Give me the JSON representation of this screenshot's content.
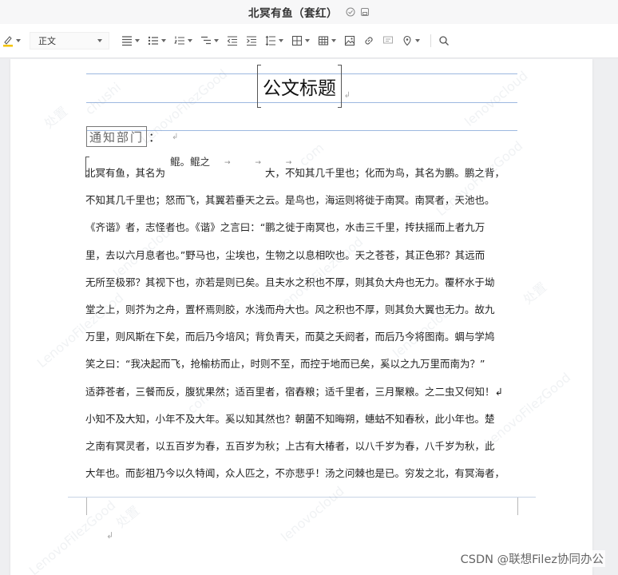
{
  "window": {
    "title": "北冥有鱼（套红）",
    "status_icons": [
      "check-circle-icon",
      "save-icon"
    ]
  },
  "toolbar": {
    "paragraph_style": "正文",
    "tools": [
      "highlight-pen-icon",
      "align-icon",
      "bullet-list-icon",
      "numbered-list-icon",
      "multilevel-list-icon",
      "outdent-icon",
      "indent-icon",
      "line-spacing-icon",
      "border-icon",
      "table-icon",
      "image-icon",
      "link-icon",
      "comment-icon",
      "location-icon",
      "search-icon"
    ]
  },
  "document": {
    "heading": "公文标题",
    "paragraph_mark": "↲",
    "notice_label": "通知部门",
    "notice_colon": "：",
    "fish_line": "鲲。鲲之",
    "arrows": "→ → →",
    "lines": [
      "北冥有鱼，其名为　　　　　　　　　　大，不知其几千里也；化而为鸟，其名为鹏。鹏之背，",
      "不知其几千里也；怒而飞，其翼若垂天之云。是鸟也，海运则将徙于南冥。南冥者，天池也。",
      "《齐谐》者，志怪者也。《谐》之言曰：“鹏之徙于南冥也，水击三千里，抟扶摇而上者九万",
      "里，去以六月息者也。”野马也，尘埃也，生物之以息相吹也。天之苍苍，其正色邪？其远而",
      "无所至极邪？其视下也，亦若是则已矣。且夫水之积也不厚，则其负大舟也无力。覆杯水于坳",
      "堂之上，则芥为之舟，置杯焉则胶，水浅而舟大也。风之积也不厚，则其负大翼也无力。故九",
      "万里，则风斯在下矣，而后乃今培风；背负青天，而莫之夭阏者，而后乃今将图南。蜩与学鸠",
      "笑之曰：“我决起而飞，抢榆枋而止，时则不至，而控于地而已矣，奚以之九万里而南为？”",
      "适莽苍者，三餐而反，腹犹果然；适百里者，宿舂粮；适千里者，三月聚粮。之二虫又何知！↲",
      "小知不及大知，小年不及大年。奚以知其然也？朝菌不知晦朔，蟪蛄不知春秋，此小年也。楚",
      "之南有冥灵者，以五百岁为春，五百岁为秋；上古有大椿者，以八千岁为春，八千岁为秋，此",
      "大年也。而彭祖乃今以久特闻，众人匹之，不亦悲乎！汤之问棘也是已。穷发之北，有冥海者，"
    ]
  },
  "watermark": {
    "texts": [
      "处置",
      "chushi",
      "LenovoFilezGood",
      "lenovocloud",
      "com"
    ]
  },
  "credit": "CSDN @联想Filez协同办公",
  "colors": {
    "accent_line": "#9db8e0",
    "page": "#ffffff",
    "canvas": "#eeeff1"
  }
}
